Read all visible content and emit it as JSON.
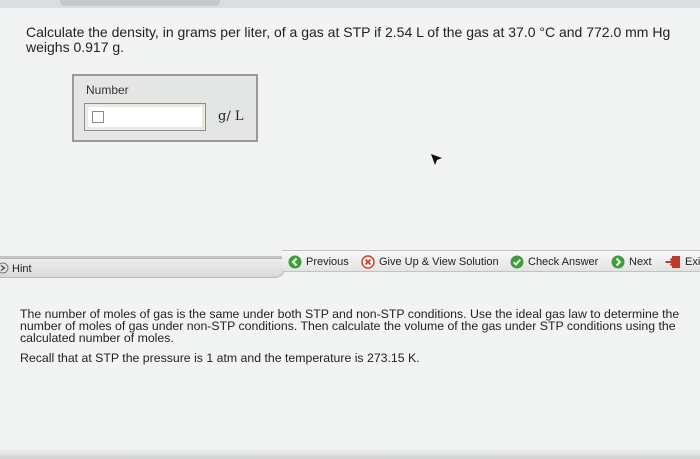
{
  "question": {
    "line1": "Calculate the density, in grams per liter, of a gas at STP if 2.54 L of the gas at 37.0 °C and 772.0 mm Hg",
    "line2": "weighs 0.917 g."
  },
  "answer": {
    "label": "Number",
    "value": "",
    "unit": "g/ L"
  },
  "hint": {
    "tab_label": "Hint",
    "paragraph1": "The number of moles of gas is the same under both STP and non-STP conditions. Use the ideal gas law to determine the number of moles of gas under non-STP conditions. Then calculate the volume of the gas under STP conditions using the calculated number of moles.",
    "paragraph2": "Recall that at STP the pressure is 1 atm and the temperature is 273.15 K."
  },
  "actions": {
    "previous": "Previous",
    "give_up": "Give Up & View Solution",
    "check": "Check Answer",
    "next": "Next",
    "exit": "Exi"
  },
  "icons": {
    "previous": "green-left-arrow-icon",
    "give_up": "red-x-circle-icon",
    "check": "green-check-circle-icon",
    "next": "green-right-arrow-icon",
    "exit": "exit-door-icon",
    "hint": "hint-chevron-icon"
  },
  "colors": {
    "green": "#3f9e37",
    "red": "#d23c2a",
    "background": "#f2f3f3"
  }
}
